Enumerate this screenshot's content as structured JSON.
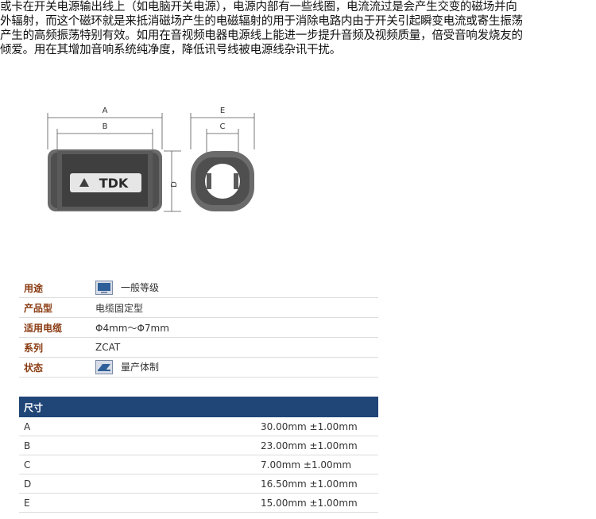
{
  "intro": {
    "lines": [
      "或卡在开关电源输出线上（如电脑开关电源），电源内部有一些线圈，电流流过是会产生交变的磁场并向",
      "外辐射，而这个磁环就是来抵消磁场产生的电磁辐射的用于消除电路内由于开关引起瞬变电流或寄生振荡",
      "产生的高频振荡特别有效。如用在音视频电器电源线上能进一步提升音频及视频质量，倍受音响发烧友的",
      "倾爱。用在其增加音响系统纯净度，降低讯号线被电源线杂讯干扰。"
    ]
  },
  "drawing": {
    "brand": "TDK",
    "labels": {
      "a": "A",
      "b": "B",
      "c": "C",
      "d": "D",
      "e": "E"
    }
  },
  "spec": {
    "rows": [
      {
        "key": "用途",
        "value": "一般等级",
        "icon": "monitor-icon"
      },
      {
        "key": "产品型",
        "value": "电缆固定型",
        "icon": ""
      },
      {
        "key": "适用电缆",
        "value": "Φ4mm～Φ7mm",
        "icon": ""
      },
      {
        "key": "系列",
        "value": "ZCAT",
        "icon": ""
      },
      {
        "key": "状态",
        "value": "量产体制",
        "icon": "mass-production-icon"
      }
    ]
  },
  "dimensions": {
    "header": "尺寸",
    "rows": [
      {
        "name": "A",
        "value": "30.00mm ±1.00mm"
      },
      {
        "name": "B",
        "value": "23.00mm ±1.00mm"
      },
      {
        "name": "C",
        "value": "7.00mm ±1.00mm"
      },
      {
        "name": "D",
        "value": "16.50mm ±1.00mm"
      },
      {
        "name": "E",
        "value": "15.00mm ±1.00mm"
      }
    ]
  }
}
